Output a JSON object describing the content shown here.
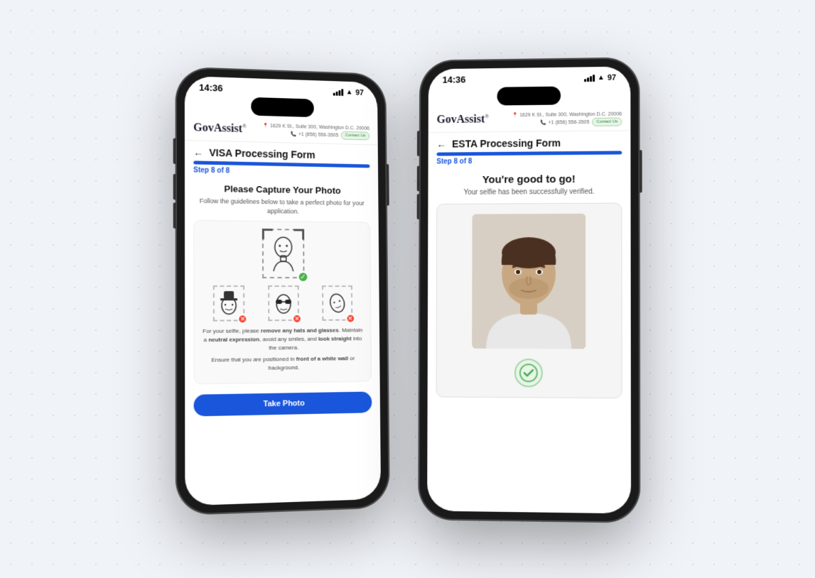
{
  "background_color": "#f0f3f8",
  "left_phone": {
    "status_bar": {
      "time": "14:36",
      "battery": "97",
      "signal": "full",
      "wifi": true
    },
    "header": {
      "brand": "GovAssist",
      "address": "1629 K St., Suite 300, Washington D.C. 20006",
      "phone": "+1 (856) 556-3505",
      "contact_btn": "Contact Us"
    },
    "form": {
      "title": "VISA Processing Form",
      "step_label": "Step 8 of 8",
      "progress_pct": 100,
      "heading": "Please Capture Your Photo",
      "subtext": "Follow the guidelines below to take a perfect photo for your application.",
      "good_example_label": "correct face",
      "bad_example_labels": [
        "hat",
        "sunglasses",
        "head tilt"
      ],
      "guideline_text1": "For your selfie, please remove any hats and glasses. Maintain a neutral expression, avoid any smiles, and look straight into the camera.",
      "guideline_text2": "Ensure that you are positioned in front of a white wall or background.",
      "take_photo_btn": "Take Photo"
    }
  },
  "right_phone": {
    "status_bar": {
      "time": "14:36",
      "battery": "97",
      "signal": "full",
      "wifi": true
    },
    "header": {
      "brand": "GovAssist",
      "address": "1629 K St., Suite 300, Washington D.C. 20006",
      "phone": "+1 (856) 556-3505",
      "contact_btn": "Contact Us"
    },
    "form": {
      "title": "ESTA Processing Form",
      "step_label": "Step 8 of 8",
      "progress_pct": 100,
      "heading": "You're good to go!",
      "subtext": "Your selfie has been successfully verified.",
      "verified_icon": "check-circle"
    }
  }
}
